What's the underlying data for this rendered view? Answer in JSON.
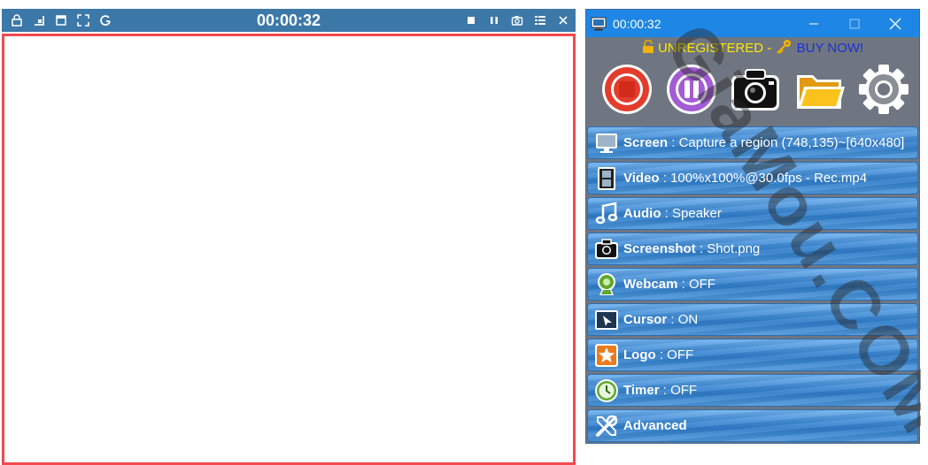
{
  "region": {
    "timer": "00:00:32",
    "frame_color": "#f24a4f",
    "bar_color": "#3c78a8",
    "left_buttons": [
      "lock-icon",
      "align-bottom-right-icon",
      "window-icon",
      "fullscreen-icon",
      "refresh-icon"
    ],
    "right_buttons": [
      "stop-icon",
      "pause-icon",
      "camera-icon",
      "list-icon",
      "close-icon"
    ]
  },
  "window": {
    "title": "00:00:32",
    "titlebar_color": "#1e87e6",
    "registration": {
      "unregistered": "UNREGISTERED - ",
      "buy": "BUY NOW!"
    },
    "toolbar": [
      "stop-record-icon",
      "pause-record-icon",
      "screenshot-camera-icon",
      "open-folder-icon",
      "settings-gear-icon"
    ],
    "rows": [
      {
        "name": "Screen",
        "value": "Capture a region (748,135)~[640x480]",
        "icon": "monitor-icon"
      },
      {
        "name": "Video",
        "value": "100%x100%@30.0fps - Rec.mp4",
        "icon": "film-icon"
      },
      {
        "name": "Audio",
        "value": "Speaker",
        "icon": "music-note-icon"
      },
      {
        "name": "Screenshot",
        "value": "Shot.png",
        "icon": "camera-icon"
      },
      {
        "name": "Webcam",
        "value": "OFF",
        "icon": "webcam-icon"
      },
      {
        "name": "Cursor",
        "value": "ON",
        "icon": "cursor-icon"
      },
      {
        "name": "Logo",
        "value": "OFF",
        "icon": "star-logo-icon"
      },
      {
        "name": "Timer",
        "value": "OFF",
        "icon": "clock-icon"
      },
      {
        "name": "Advanced",
        "value": "",
        "icon": "tools-icon"
      }
    ]
  },
  "watermark": "GiaMou.COM"
}
